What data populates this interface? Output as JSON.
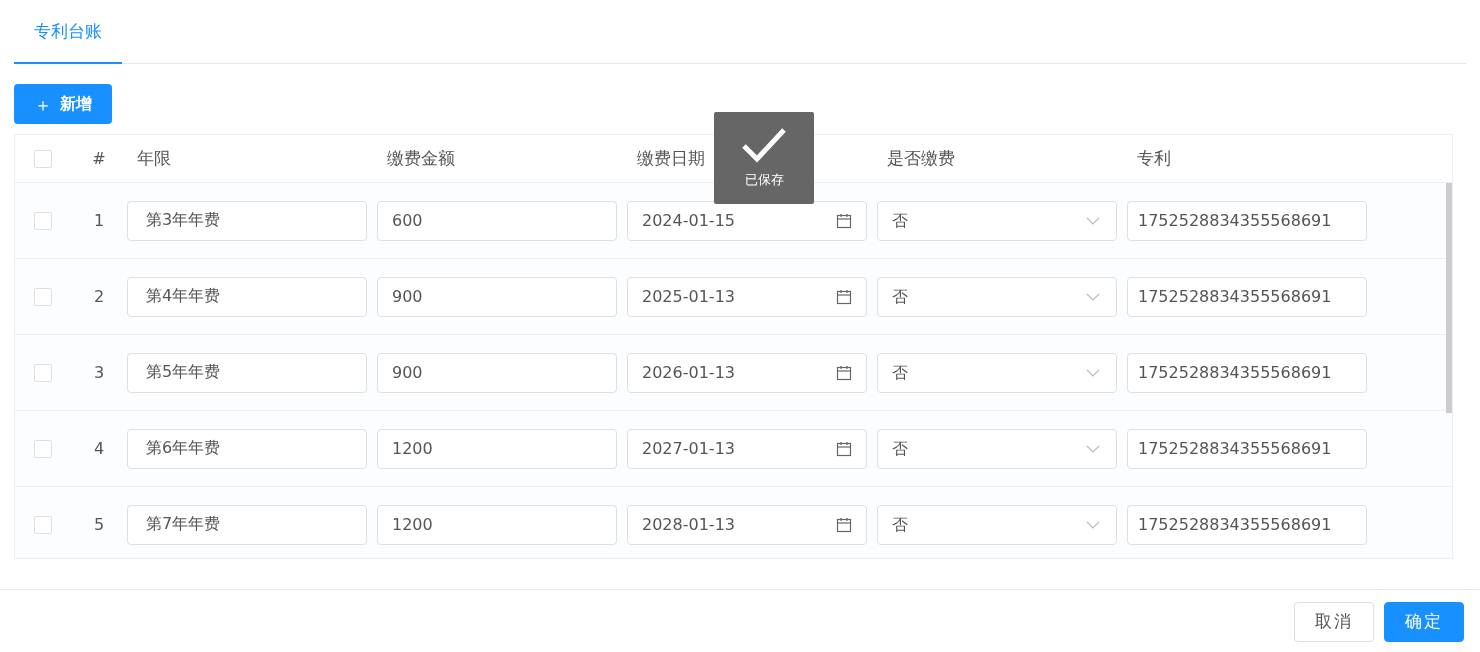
{
  "tabs": [
    {
      "label": "专利台账",
      "selected": true
    }
  ],
  "add_button": {
    "icon": "＋",
    "label": "新增"
  },
  "table": {
    "header_checked": false,
    "columns": [
      "#",
      "年限",
      "缴费金额",
      "缴费日期",
      "是否缴费",
      "专利"
    ],
    "rows": [
      {
        "checked": false,
        "index": "1",
        "term": "第3年年费",
        "amount": "600",
        "date": "2024-01-15",
        "paid": "否",
        "patent": "1752528834355568691"
      },
      {
        "checked": false,
        "index": "2",
        "term": "第4年年费",
        "amount": "900",
        "date": "2025-01-13",
        "paid": "否",
        "patent": "1752528834355568691"
      },
      {
        "checked": false,
        "index": "3",
        "term": "第5年年费",
        "amount": "900",
        "date": "2026-01-13",
        "paid": "否",
        "patent": "1752528834355568691"
      },
      {
        "checked": false,
        "index": "4",
        "term": "第6年年费",
        "amount": "1200",
        "date": "2027-01-13",
        "paid": "否",
        "patent": "1752528834355568691"
      },
      {
        "checked": false,
        "index": "5",
        "term": "第7年年费",
        "amount": "1200",
        "date": "2028-01-13",
        "paid": "否",
        "patent": "1752528834355568691"
      }
    ]
  },
  "toast": {
    "text": "已保存"
  },
  "footer_buttons": [
    {
      "label": "取消",
      "kind": "secondary"
    },
    {
      "label": "确定",
      "kind": "primary"
    }
  ]
}
